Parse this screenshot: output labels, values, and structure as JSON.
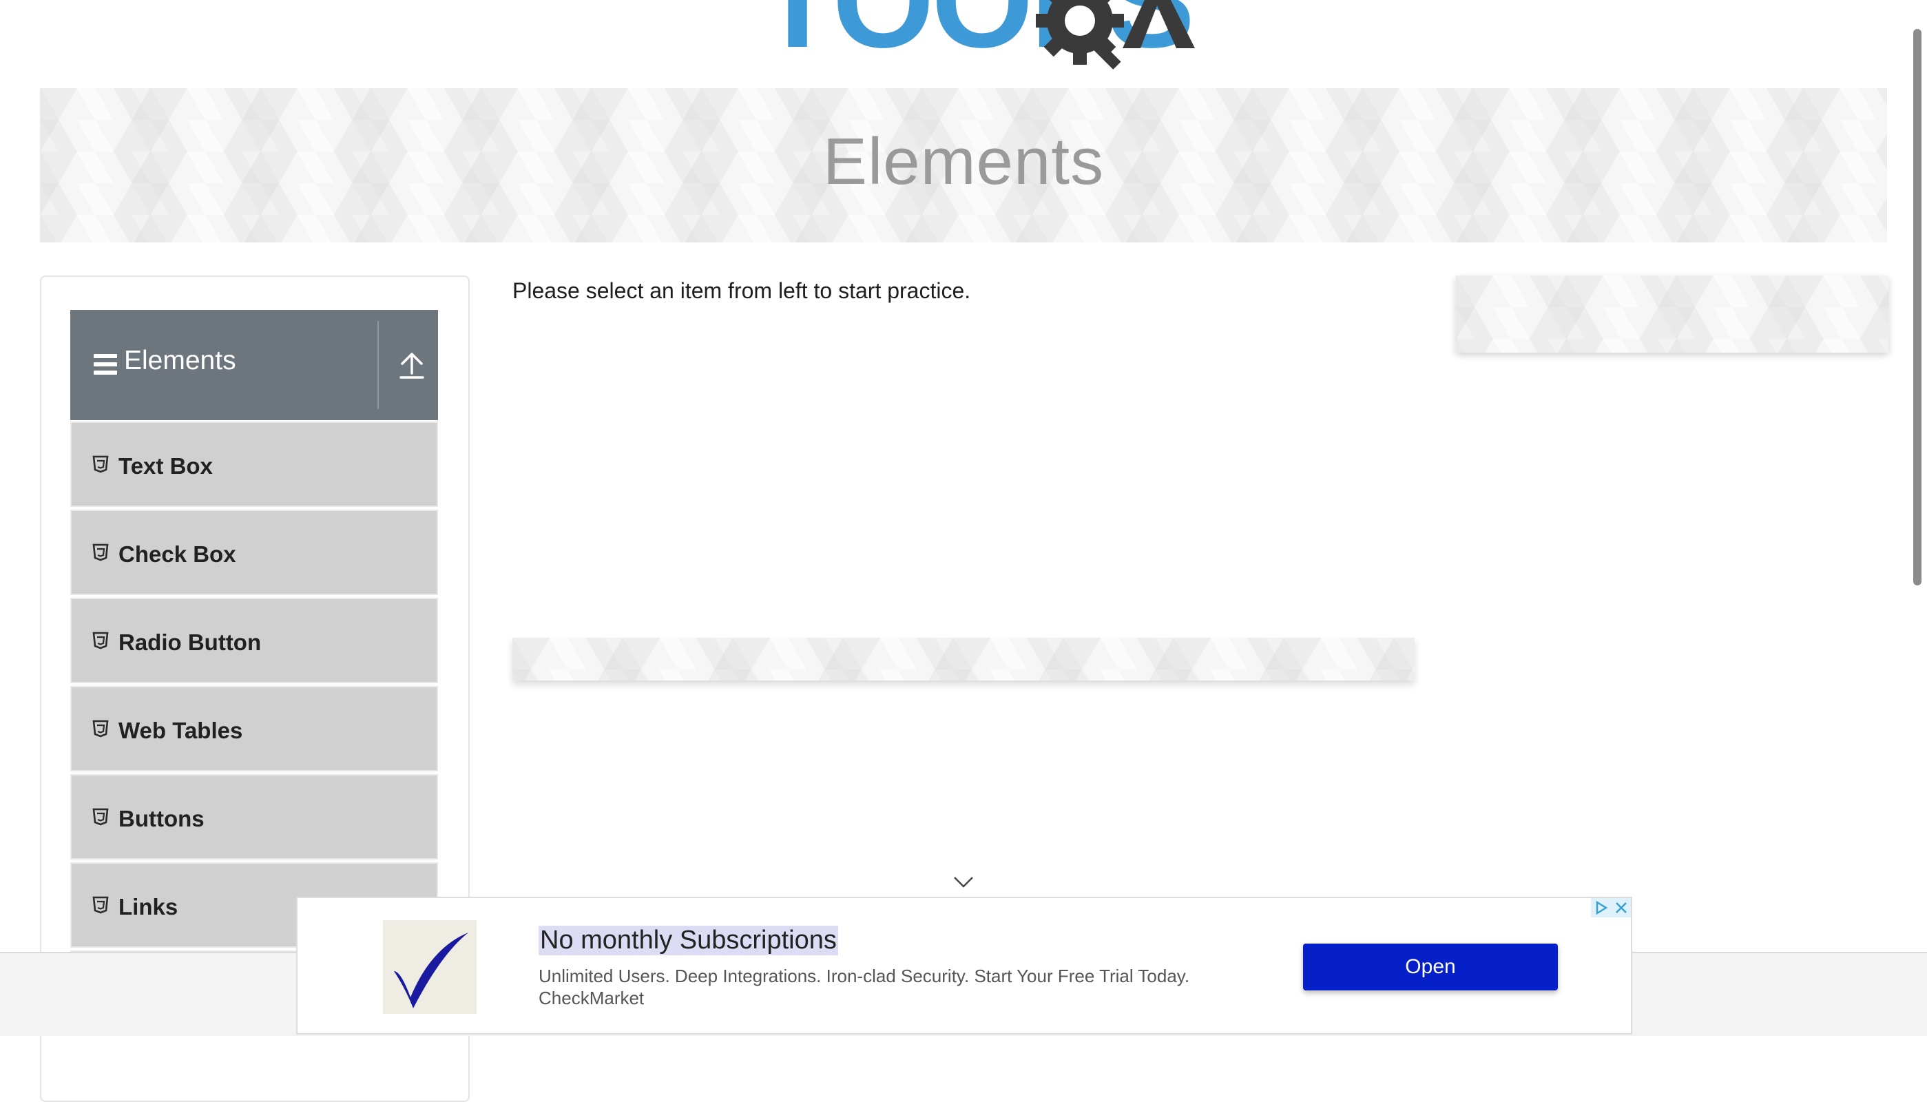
{
  "brand": {
    "logo_text": "TOOLSQA"
  },
  "banner": {
    "title": "Elements"
  },
  "sidebar": {
    "group_title": "Elements",
    "items": [
      {
        "label": "Text Box"
      },
      {
        "label": "Check Box"
      },
      {
        "label": "Radio Button"
      },
      {
        "label": "Web Tables"
      },
      {
        "label": "Buttons"
      },
      {
        "label": "Links"
      }
    ]
  },
  "main": {
    "intro_text": "Please select an item from left to start practice."
  },
  "ad": {
    "headline": "No monthly Subscriptions",
    "description": "Unlimited Users. Deep Integrations. Iron-clad Security. Start Your Free Trial Today.",
    "advertiser": "CheckMarket",
    "cta_label": "Open"
  },
  "colors": {
    "logo_blue": "#3d9ad6",
    "logo_dark": "#3a3a3a",
    "sidebar_header": "#6d757d",
    "menu_item_bg": "#d0d0d0",
    "ad_button": "#0520c8"
  },
  "icons": {
    "menu": "hamburger-icon",
    "collapse": "upload-arrow-icon",
    "item": "html5-shield-icon",
    "scroll": "chevron-down-icon"
  }
}
